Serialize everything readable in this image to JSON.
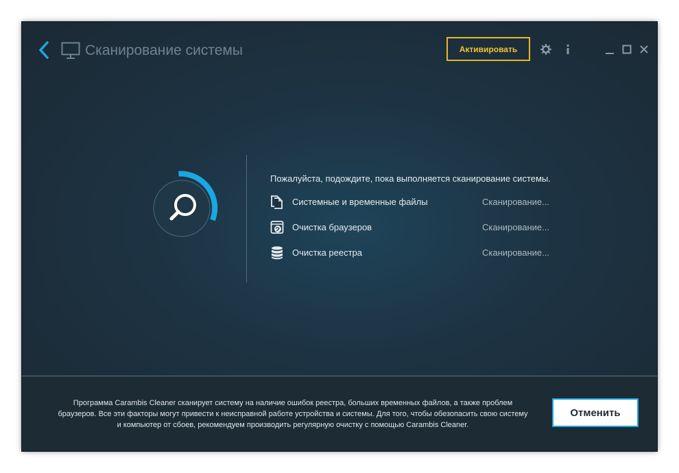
{
  "header": {
    "title": "Сканирование системы",
    "activate_label": "Активировать",
    "icons": {
      "back": "chevron-left-icon",
      "monitor": "monitor-icon",
      "settings": "gear-icon",
      "info": "info-icon",
      "minimize": "minimize-icon",
      "maximize": "maximize-icon",
      "close": "close-icon"
    }
  },
  "scan": {
    "progress_icon": "search-icon",
    "wait_message": "Пожалуйста, подождите, пока выполняется сканирование системы.",
    "items": [
      {
        "label": "Системные и временные файлы",
        "status": "Сканирование...",
        "icon": "files-icon"
      },
      {
        "label": "Очистка браузеров",
        "status": "Сканирование...",
        "icon": "browser-icon"
      },
      {
        "label": "Очистка реестра",
        "status": "Сканирование...",
        "icon": "database-icon"
      }
    ]
  },
  "footer": {
    "description": "Программа Carambis Cleaner сканирует систему на наличие ошибок реестра, больших временных файлов, а также проблем браузеров. Все эти факторы могут привести к неисправной работе устройства и системы. Для того, чтобы обезопасить свою систему и компьютер от сбоев, рекомендуем производить регулярную очистку с помощью Carambis Cleaner.",
    "cancel_label": "Отменить"
  },
  "colors": {
    "accent_blue": "#1aa7e3",
    "activate_yellow": "#e8b923",
    "background_dark": "#1d2b34"
  }
}
